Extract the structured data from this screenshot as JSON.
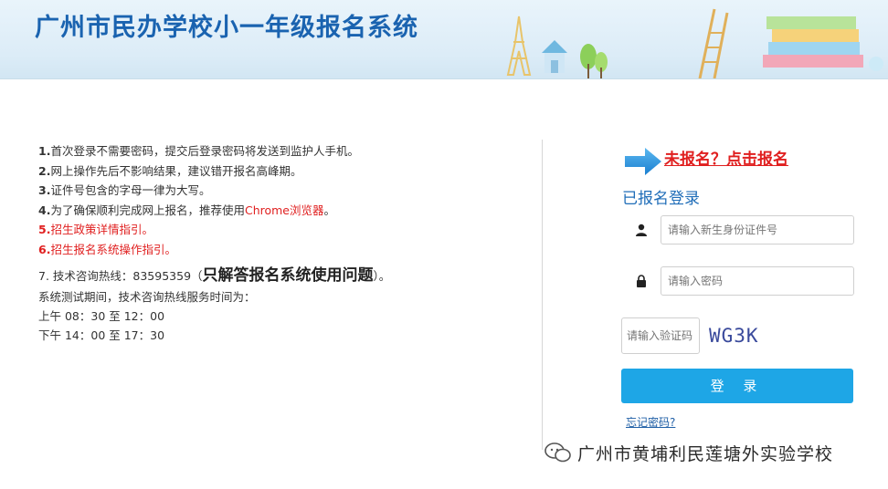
{
  "header": {
    "title": "广州市民办学校小一年级报名系统"
  },
  "info": {
    "items": [
      {
        "num": "1.",
        "text": "首次登录不需要密码，提交后登录密码将发送到监护人手机。"
      },
      {
        "num": "2.",
        "text": "网上操作先后不影响结果，建议错开报名高峰期。"
      },
      {
        "num": "3.",
        "text": "证件号包含的字母一律为大写。"
      },
      {
        "num": "4.",
        "text": "为了确保顺利完成网上报名，推荐使用",
        "highlight": "Chrome浏览器",
        "tail": "。"
      },
      {
        "num": "5.",
        "text": "招生政策详情指引。"
      },
      {
        "num": "6.",
        "text": "招生报名系统操作指引。"
      }
    ],
    "hotline_prefix": "7. 技术咨询热线：83595359（",
    "hotline_bold": "只解答报名系统使用问题",
    "hotline_suffix": "）。",
    "service_intro": "系统测试期间，技术咨询热线服务时间为：",
    "morning": "上午 08：30 至 12：00",
    "afternoon": "下午 14：00 至 17：30"
  },
  "login": {
    "register_link": "未报名？点击报名",
    "heading": "已报名登录",
    "id_placeholder": "请输入新生身份证件号",
    "password_placeholder": "请输入密码",
    "captcha_placeholder": "请输入验证码",
    "captcha_code": "WG3K",
    "login_button": "登 录",
    "forgot_link": "忘记密码?"
  },
  "watermark": {
    "text": "广州市黄埔利民莲塘外实验学校"
  },
  "colors": {
    "title": "#1a63b0",
    "accent_red": "#e01f1f",
    "button": "#1ea6e6",
    "link": "#1f5fa6"
  }
}
